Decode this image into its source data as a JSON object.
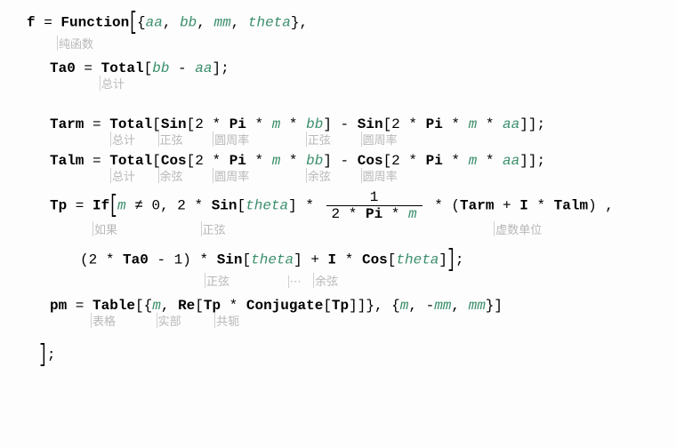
{
  "l1": {
    "f": "f",
    "eq": " = ",
    "Function": "Function",
    "lb": "[",
    "lc": "{",
    "aa": "aa",
    "c1": ", ",
    "bb": "bb",
    "c2": ", ",
    "mm": "mm",
    "c3": ", ",
    "theta": "theta",
    "rc": "}",
    "comma": ","
  },
  "h1": {
    "function": "纯函数"
  },
  "l2": {
    "Ta0": "Ta0",
    "eq": " = ",
    "Total": "Total",
    "lb": "[",
    "bb": "bb",
    "minus": " - ",
    "aa": "aa",
    "rb": "]",
    "semi": ";"
  },
  "h2": {
    "total": "总计"
  },
  "l3": {
    "Tarm": "Tarm",
    "eq": " = ",
    "Total": "Total",
    "lb": "[",
    "Sin1": "Sin",
    "lb1": "[",
    "two1": "2",
    "st1": " * ",
    "Pi1": "Pi",
    "st2": " * ",
    "m1": "m",
    "st3": " * ",
    "bb": "bb",
    "rb1": "]",
    "minus": " - ",
    "Sin2": "Sin",
    "lb2": "[",
    "two2": "2",
    "st4": " * ",
    "Pi2": "Pi",
    "st5": " * ",
    "m2": "m",
    "st6": " * ",
    "aa": "aa",
    "rb2": "]",
    "rb": "]",
    "semi": ";"
  },
  "h3": {
    "total": "总计",
    "sin1": "正弦",
    "pi1": "圆周率",
    "sin2": "正弦",
    "pi2": "圆周率"
  },
  "l4": {
    "Talm": "Talm",
    "eq": " = ",
    "Total": "Total",
    "lb": "[",
    "Cos1": "Cos",
    "lb1": "[",
    "two1": "2",
    "st1": " * ",
    "Pi1": "Pi",
    "st2": " * ",
    "m1": "m",
    "st3": " * ",
    "bb": "bb",
    "rb1": "]",
    "minus": " - ",
    "Cos2": "Cos",
    "lb2": "[",
    "two2": "2",
    "st4": " * ",
    "Pi2": "Pi",
    "st5": " * ",
    "m2": "m",
    "st6": " * ",
    "aa": "aa",
    "rb2": "]",
    "rb": "]",
    "semi": ";"
  },
  "h4": {
    "total": "总计",
    "cos1": "余弦",
    "pi1": "圆周率",
    "cos2": "余弦",
    "pi2": "圆周率"
  },
  "l5": {
    "Tp": "Tp",
    "eq": " = ",
    "If": "If",
    "m": "m",
    "ne": " ≠ ",
    "zero": "0",
    "c1": ", ",
    "two": "2",
    "st1": " * ",
    "Sin": "Sin",
    "lb1": "[",
    "theta": "theta",
    "rb1": "]",
    "st2": " * ",
    "fracTop": "1",
    "fracBot_2": "2",
    "fracBot_s1": " * ",
    "fracBot_Pi": "Pi",
    "fracBot_s2": " * ",
    "fracBot_m": "m",
    "st3": " * ",
    "lp": "(",
    "Tarm": "Tarm",
    "plus": " + ",
    "I": "I",
    "st4": " * ",
    "Talm": "Talm",
    "rp": ")",
    "c2": " ,"
  },
  "h5": {
    "if": "如果",
    "sin": "正弦",
    "iunit": "虚数单位"
  },
  "l6": {
    "lp": "(",
    "two": "2",
    "st1": " * ",
    "Ta0": "Ta0",
    "minus": " - ",
    "one": "1",
    "rp": ")",
    "st2": " * ",
    "Sin": "Sin",
    "lb1": "[",
    "theta1": "theta",
    "rb1": "]",
    "plus": " + ",
    "I": "I",
    "st3": " * ",
    "Cos": "Cos",
    "lb2": "[",
    "theta2": "theta",
    "rb2": "]",
    "semi": ";"
  },
  "h6": {
    "sin": "正弦",
    "dots": "⋯",
    "cos": "余弦"
  },
  "l7": {
    "pm": "pm",
    "eq": " = ",
    "Table": "Table",
    "lb": "[",
    "lc": "{",
    "m1": "m",
    "c1": ", ",
    "Re": "Re",
    "lb1": "[",
    "Tp1": "Tp",
    "st1": " * ",
    "Conj": "Conjugate",
    "lb2": "[",
    "Tp2": "Tp",
    "rb2": "]",
    "rb1": "]",
    "rc": "}",
    "c2": ", ",
    "lc2": "{",
    "m2": "m",
    "c3": ", ",
    "neg": "-",
    "mm1": "mm",
    "c4": ", ",
    "mm2": "mm",
    "rc2": "}",
    "rb": "]"
  },
  "h7": {
    "table": "表格",
    "re": "实部",
    "conj": "共轭"
  },
  "l8": {
    "rb": "]",
    "semi": ";"
  }
}
